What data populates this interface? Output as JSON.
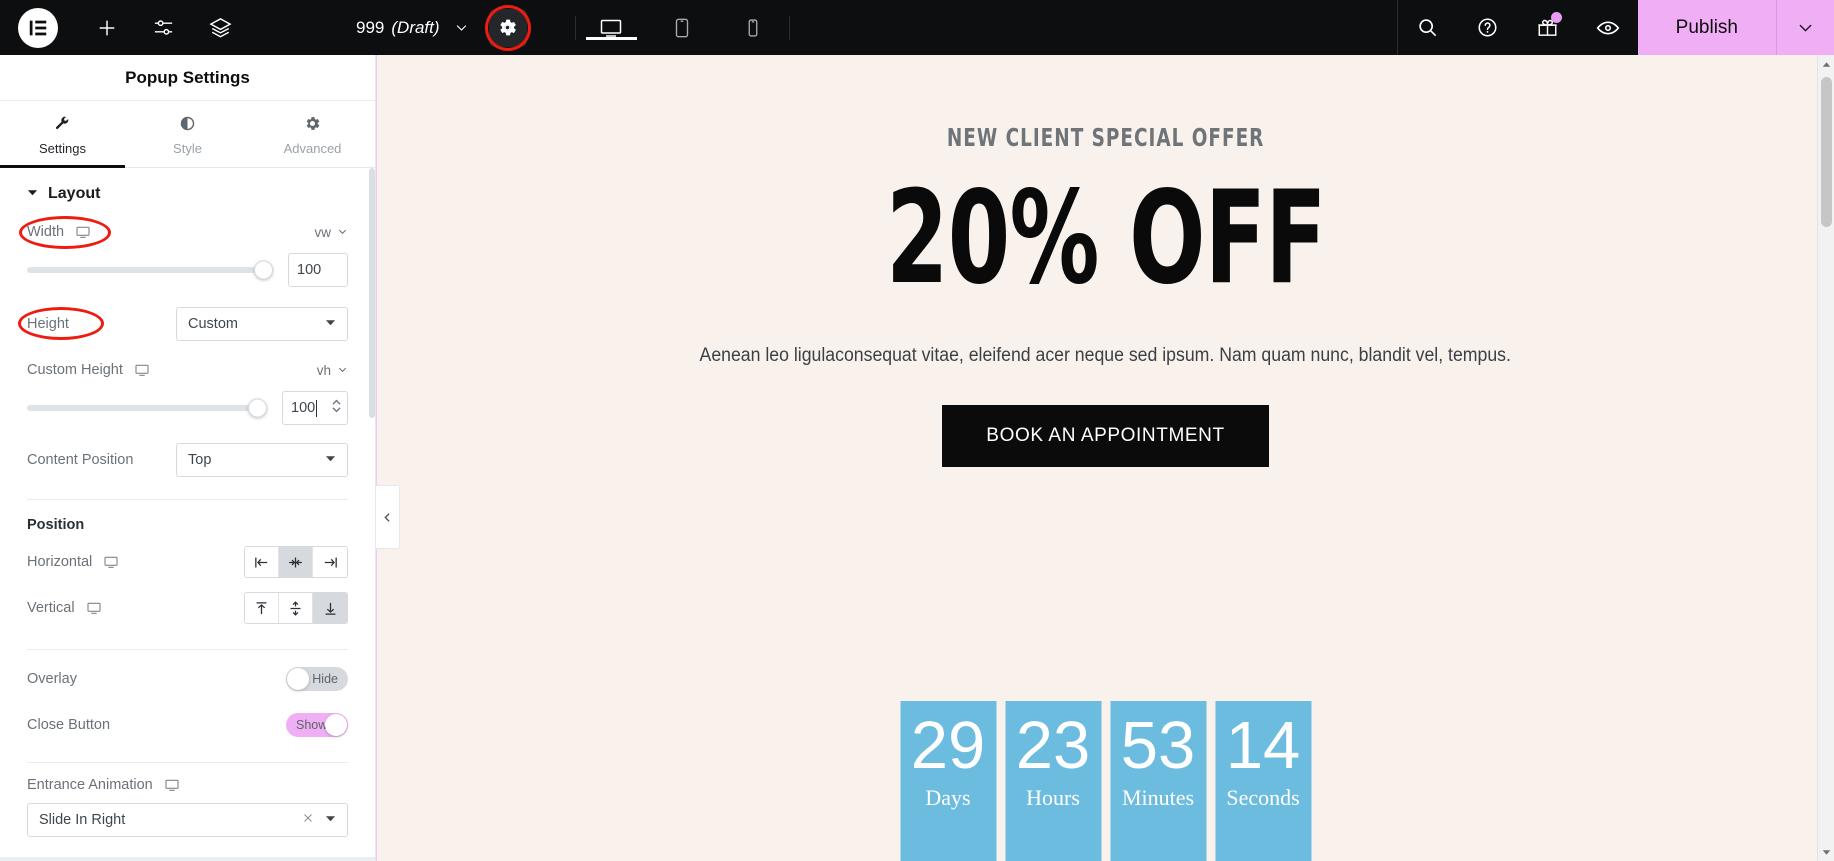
{
  "topbar": {
    "logo_icon": "elementor-logo-icon",
    "add_icon": "plus-icon",
    "settings_sliders_icon": "sliders-icon",
    "layers_icon": "layers-icon",
    "document_title": "999",
    "document_state": "(Draft)",
    "document_chevron_icon": "chevron-down-icon",
    "page_settings_icon": "gear-icon",
    "devices": [
      {
        "name": "desktop",
        "icon": "monitor-icon",
        "active": true
      },
      {
        "name": "tablet",
        "icon": "tablet-icon",
        "active": false
      },
      {
        "name": "mobile",
        "icon": "mobile-icon",
        "active": false
      }
    ],
    "right_icons": [
      {
        "name": "search-icon"
      },
      {
        "name": "help-icon"
      },
      {
        "name": "gift-icon"
      },
      {
        "name": "preview-icon"
      }
    ],
    "publish_label": "Publish",
    "publish_chevron_icon": "chevron-down-icon"
  },
  "sidebar": {
    "panel_title": "Popup Settings",
    "tabs": [
      {
        "label": "Settings",
        "icon": "wrench-icon",
        "active": true
      },
      {
        "label": "Style",
        "icon": "contrast-icon",
        "active": false
      },
      {
        "label": "Advanced",
        "icon": "gear-icon",
        "active": false
      }
    ],
    "section": {
      "title": "Layout",
      "collapse_icon": "caret-down-icon"
    },
    "width": {
      "label": "Width",
      "responsive_icon": "monitor-icon",
      "unit": "vw",
      "unit_chevron_icon": "chevron-down-icon",
      "value": "100",
      "slider_percent": 100,
      "annotated": true
    },
    "height": {
      "label": "Height",
      "value": "Custom",
      "dropdown_icon": "caret-down-icon",
      "annotated": true
    },
    "custom_height": {
      "label": "Custom Height",
      "responsive_icon": "monitor-icon",
      "unit": "vh",
      "unit_chevron_icon": "chevron-down-icon",
      "value": "100",
      "slider_percent": 100,
      "spinner_icon": "stepper-icon",
      "focused": true
    },
    "content_position": {
      "label": "Content Position",
      "value": "Top",
      "dropdown_icon": "caret-down-icon"
    },
    "position_group_label": "Position",
    "horizontal": {
      "label": "Horizontal",
      "responsive_icon": "monitor-icon",
      "options": [
        {
          "name": "align-left",
          "icon": "align-left-icon",
          "selected": false
        },
        {
          "name": "align-center",
          "icon": "align-center-icon",
          "selected": true
        },
        {
          "name": "align-right",
          "icon": "align-right-icon",
          "selected": false
        }
      ]
    },
    "vertical": {
      "label": "Vertical",
      "responsive_icon": "monitor-icon",
      "options": [
        {
          "name": "align-top",
          "icon": "align-top-icon",
          "selected": false
        },
        {
          "name": "align-middle",
          "icon": "align-middle-icon",
          "selected": false
        },
        {
          "name": "align-bottom",
          "icon": "align-bottom-icon",
          "selected": true
        }
      ]
    },
    "overlay": {
      "label": "Overlay",
      "state_label": "Hide",
      "on": false
    },
    "close_button": {
      "label": "Close Button",
      "state_label": "Show",
      "on": true
    },
    "entrance_animation": {
      "label": "Entrance Animation",
      "responsive_icon": "monitor-icon",
      "value": "Slide In Right",
      "clear_icon": "close-icon",
      "dropdown_icon": "caret-down-icon"
    },
    "collapse_panel_icon": "chevron-left-icon"
  },
  "canvas": {
    "eyebrow": "NEW CLIENT SPECIAL OFFER",
    "headline": "20% OFF",
    "subtext": "Aenean leo ligulaconsequat vitae, eleifend acer neque sed ipsum. Nam quam nunc, blandit vel, tempus.",
    "cta_label": "BOOK AN APPOINTMENT",
    "countdown": [
      {
        "value": "29",
        "label": "Days"
      },
      {
        "value": "23",
        "label": "Hours"
      },
      {
        "value": "53",
        "label": "Minutes"
      },
      {
        "value": "14",
        "label": "Seconds"
      }
    ],
    "colors": {
      "popup_background": "#f9f2ec",
      "countdown_background": "#6cbce0",
      "cta_background": "#0b0b0b",
      "accent_pink": "#f0aff5",
      "annotation_red": "#ee1b11"
    }
  },
  "scrollbar": {
    "up_arrow_icon": "caret-up-icon",
    "down_arrow_icon": "caret-down-icon"
  }
}
